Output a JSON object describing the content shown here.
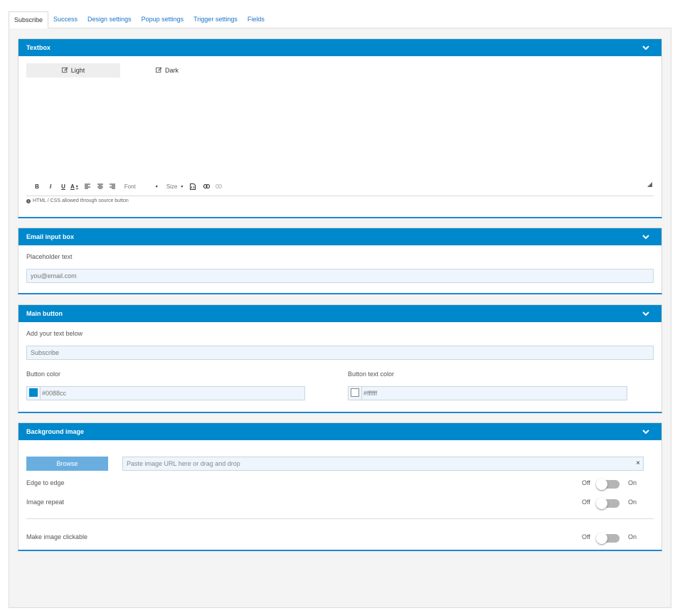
{
  "tabs": [
    {
      "label": "Subscribe",
      "active": true
    },
    {
      "label": "Success"
    },
    {
      "label": "Design settings"
    },
    {
      "label": "Popup settings"
    },
    {
      "label": "Trigger settings"
    },
    {
      "label": "Fields"
    }
  ],
  "textbox": {
    "title": "Textbox",
    "light_label": "Light",
    "dark_label": "Dark",
    "toolbar": {
      "bold": "B",
      "italic": "I",
      "underline": "U",
      "text_color": "A",
      "font_label": "Font",
      "size_label": "Size"
    },
    "hint": "HTML / CSS allowed through source button"
  },
  "email_input": {
    "title": "Email input box",
    "placeholder_label": "Placeholder text",
    "placeholder_value": "you@email.com"
  },
  "main_button": {
    "title": "Main button",
    "text_label": "Add your text below",
    "text_placeholder": "Subscribe",
    "button_color_label": "Button color",
    "button_color_value": "#0088cc",
    "button_text_color_label": "Button text color",
    "button_text_color_value": "#ffffff"
  },
  "background_image": {
    "title": "Background image",
    "browse_label": "Browse",
    "url_placeholder": "Paste image URL here or drag and drop",
    "clear_label": "×",
    "edge_label": "Edge to edge",
    "repeat_label": "Image repeat",
    "clickable_label": "Make image clickable",
    "off_label": "Off",
    "on_label": "On"
  },
  "colors": {
    "accent": "#0088cc",
    "field_bg": "#eef5fc",
    "browse_bg": "#6aaee0"
  }
}
